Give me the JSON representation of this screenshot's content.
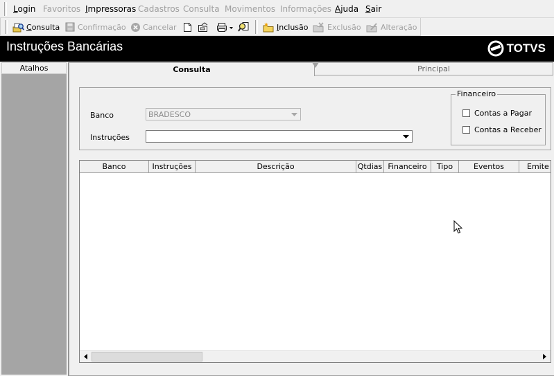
{
  "menu": {
    "items": [
      {
        "label": "Login",
        "mnemonic": "L",
        "rest": "ogin",
        "enabled": true
      },
      {
        "label": "Favoritos",
        "mnemonic": "",
        "rest": "Favoritos",
        "enabled": false
      },
      {
        "label": "Impressoras",
        "mnemonic": "I",
        "rest": "mpressoras",
        "enabled": true
      },
      {
        "label": "Cadastros",
        "mnemonic": "",
        "rest": "Cadastros",
        "enabled": false
      },
      {
        "label": "Consulta",
        "mnemonic": "",
        "rest": "Consulta",
        "enabled": false
      },
      {
        "label": "Movimentos",
        "mnemonic": "",
        "rest": "Movimentos",
        "enabled": false
      },
      {
        "label": "Informações",
        "mnemonic": "",
        "rest": "Informações",
        "enabled": false
      },
      {
        "label": "Ajuda",
        "mnemonic": "A",
        "rest": "juda",
        "enabled": true
      },
      {
        "label": "Sair",
        "mnemonic": "S",
        "rest": "air",
        "enabled": true
      }
    ]
  },
  "toolbar": {
    "consulta": {
      "mnemonic": "C",
      "rest": "onsulta"
    },
    "confirmacao": "Confirmação",
    "cancelar": "Cancelar",
    "inclusao": {
      "mnemonic": "I",
      "rest": "nclusão"
    },
    "exclusao": "Exclusão",
    "alteracao": "Alteração"
  },
  "header": {
    "title": "Instruções Bancárias",
    "logo_text": "TOTVS"
  },
  "sidebar": {
    "title": "Atalhos"
  },
  "tabs": [
    {
      "label": "Consulta",
      "active": true
    },
    {
      "label": "Principal",
      "active": false
    }
  ],
  "form": {
    "banco_label": "Banco",
    "banco_value": "BRADESCO",
    "instrucoes_label": "Instruções",
    "instrucoes_value": "",
    "financeiro": {
      "legend": "Financeiro",
      "options": [
        {
          "label": "Contas a Pagar",
          "checked": false
        },
        {
          "label": "Contas a Receber",
          "checked": false
        }
      ]
    }
  },
  "grid": {
    "columns": [
      "Banco",
      "Instruções",
      "Descrição",
      "Qtdias",
      "Financeiro",
      "Tipo",
      "Eventos",
      "Emite r"
    ],
    "rows": []
  },
  "colors": {
    "title_bar": "#000000",
    "sidebar": "#a5a5a5",
    "window_bg": "#f0f0f0"
  }
}
